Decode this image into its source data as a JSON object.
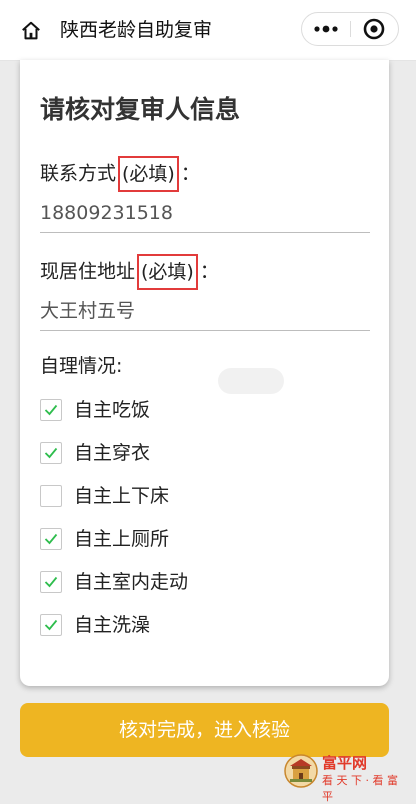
{
  "nav": {
    "title": "陕西老龄自助复审",
    "home_icon": "home-icon",
    "more_icon": "more-dots-icon",
    "close_icon": "target-close-icon"
  },
  "form": {
    "heading": "请核对复审人信息",
    "contact_label": "联系方式",
    "contact_required": "(必填)",
    "contact_colon": "：",
    "contact_value": "18809231518",
    "address_label": "现居住地址",
    "address_required": "(必填)",
    "address_colon": "：",
    "address_value": "大王村五号",
    "selfcare_label": "自理情况:",
    "options": [
      {
        "label": "自主吃饭",
        "checked": true
      },
      {
        "label": "自主穿衣",
        "checked": true
      },
      {
        "label": "自主上下床",
        "checked": false
      },
      {
        "label": "自主上厕所",
        "checked": true
      },
      {
        "label": "自主室内走动",
        "checked": true
      },
      {
        "label": "自主洗澡",
        "checked": true
      }
    ]
  },
  "confirm_button": "核对完成，进入核验",
  "watermark": {
    "line1": "富平网",
    "line2": "看 天 下 · 看 富 平"
  },
  "colors": {
    "accent": "#eeb522",
    "required_border": "#e23b3b",
    "check": "#2ebd4d"
  }
}
